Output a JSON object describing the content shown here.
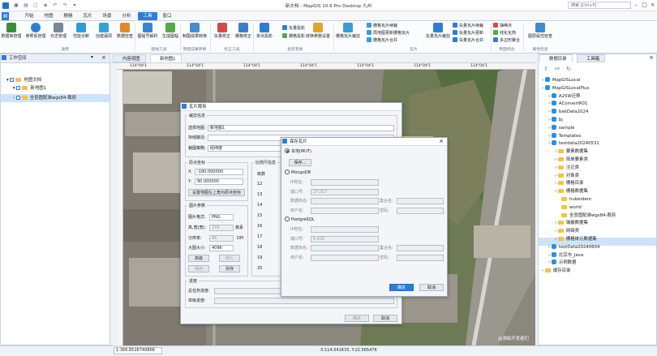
{
  "title": "新文档 - MapGIS 10.6 Pro Desktop 九州",
  "search_placeholder": "搜索 [Ctrl+F]",
  "menus": [
    "开始",
    "地图",
    "栅格",
    "瓦片",
    "场景",
    "分析",
    "工具",
    "窗口"
  ],
  "active_menu": "工具",
  "ribbon": {
    "buttons": [
      {
        "label": "数据库管理",
        "color": "#3a8d3a"
      },
      {
        "label": "参照系管理",
        "color": "#2f7dd1"
      },
      {
        "label": "日志管理",
        "color": "#7a8797"
      },
      {
        "label": "性能诊断",
        "color": "#2f9bd6"
      },
      {
        "label": "创建漏洞",
        "color": "#36a0d9"
      },
      {
        "label": "数据检查",
        "color": "#e0892d"
      },
      {
        "label": "图幅号解析",
        "color": "#3b84d0"
      },
      {
        "label": "生成图幅",
        "color": "#58a84a"
      },
      {
        "label": "制图成果转换",
        "color": "#4b8bd1"
      },
      {
        "label": "矢量校正",
        "color": "#d14b4b"
      },
      {
        "label": "栅格校正",
        "color": "#3a7fc8"
      },
      {
        "label": "单点投影",
        "color": "#2f7dd1"
      },
      {
        "label": "转换参数设置",
        "color": "#e0a52d"
      },
      {
        "label": "栅格瓦片裁剪",
        "color": "#3a9cd6"
      },
      {
        "label": "矢量瓦片裁剪",
        "color": "#2f7dd1"
      },
      {
        "label": "图层属性检查",
        "color": "#3d8bd1"
      }
    ],
    "small": {
      "proj1": "矢量投影",
      "proj2": "栅格投影",
      "tile1": "栅格瓦片续裁",
      "tile2": "局地图更新栅格瓦片",
      "tile3": "栅格瓦片合并",
      "vtile1": "矢量瓦片续裁",
      "vtile2": "矢量瓦片更新",
      "vtile3": "矢量瓦片合并",
      "gen1": "抽稀点",
      "gen2": "线化化简",
      "gen3": "多边形聚合"
    },
    "groups": [
      "通用",
      "图幅工具",
      "制图成果转换",
      "校正工具",
      "投影变换",
      "瓦片",
      "制图综合",
      "属性检查"
    ]
  },
  "left_panel": {
    "title": "工作空间",
    "items": [
      "地图文档",
      "新地图1",
      "全景图配准wgs84-裁剪"
    ]
  },
  "tabs": [
    "内容视图",
    "新地图1"
  ],
  "ruler_marks": [
    "114°04'1",
    "114°04'1",
    "114°04'1",
    "114°04'1",
    "114°04'1",
    "114°04'1",
    "114°04'1"
  ],
  "watermark": "@测绘开发者们",
  "clip_dialog": {
    "title": "瓦片裁剪",
    "section_info": "裁剪信息",
    "map_label": "选择地图:",
    "map_value": "新地图1",
    "path_label": "存储路径:",
    "scheme_label": "裁图策略:",
    "scheme_value": "经纬度",
    "origin_title": "原点坐标",
    "x_label": "X:",
    "x_value": "-180.000000",
    "y_label": "Y:",
    "y_value": "90.000000",
    "set_origin": "设置地图左上角为原点坐标",
    "img_title": "图片参数",
    "fmt_label": "图片格式:",
    "fmt_value": "PNG",
    "wh_label": "高,宽(宽):",
    "wh_value": "256",
    "wh_unit": "像素",
    "dpi_label": "分辨率:",
    "dpi_value": "96",
    "dpi_unit": "DPI",
    "size_label": "大图大小:",
    "size_value": "4096",
    "adv": "高级",
    "import": "导入",
    "save": "保存",
    "saveas": "另存",
    "scale_title": "比例尺信息",
    "level_col": "级数",
    "levels": [
      "12",
      "13",
      "14",
      "15",
      "16",
      "17",
      "18",
      "19",
      "20"
    ],
    "progress_title": "进度",
    "total_label": "总任务进度:",
    "single_label": "单级进度:",
    "ok": "确定",
    "cancel": "取消"
  },
  "save_dialog": {
    "title": "保存瓦片",
    "local": "本地(MUT)",
    "save_btn": "保存...",
    "mongo": "MongoDB",
    "ip_label": "IP地址:",
    "port_label": "端口号:",
    "mongo_port": "27,017",
    "db_label": "数据库名:",
    "col_label": "集合名:",
    "user_label": "用户名:",
    "pwd_label": "密码:",
    "pg": "PostgreSQL",
    "pg_port": "5,432",
    "ok": "确定",
    "cancel": "取消"
  },
  "right_panel": {
    "tabs": [
      "数据目录",
      "工具箱"
    ],
    "items": [
      {
        "label": "MapGISLocal",
        "indent": 0,
        "icon": "cyl"
      },
      {
        "label": "MapGISLocalPlus",
        "indent": 0,
        "icon": "cyl"
      },
      {
        "label": "A25W迁移",
        "indent": 1,
        "icon": "cyl"
      },
      {
        "label": "AConvertR01",
        "indent": 1,
        "icon": "cyl"
      },
      {
        "label": "bakData2024",
        "indent": 1,
        "icon": "cyl"
      },
      {
        "label": "bj",
        "indent": 1,
        "icon": "cyl"
      },
      {
        "label": "sample",
        "indent": 1,
        "icon": "cyl"
      },
      {
        "label": "Templates",
        "indent": 1,
        "icon": "cyl"
      },
      {
        "label": "testdata20240531",
        "indent": 1,
        "icon": "cyl"
      },
      {
        "label": "要素数据集",
        "indent": 2,
        "icon": "fold"
      },
      {
        "label": "简单要素类",
        "indent": 2,
        "icon": "fold"
      },
      {
        "label": "注记类",
        "indent": 2,
        "icon": "fold"
      },
      {
        "label": "对象类",
        "indent": 2,
        "icon": "fold"
      },
      {
        "label": "栅格目录",
        "indent": 2,
        "icon": "fold"
      },
      {
        "label": "栅格数据集",
        "indent": 2,
        "icon": "fold"
      },
      {
        "label": "hubeidem",
        "indent": 3,
        "icon": "fold"
      },
      {
        "label": "world",
        "indent": 3,
        "icon": "fold"
      },
      {
        "label": "全景图配准wgs84-裁剪",
        "indent": 3,
        "icon": "fold",
        "selected": true
      },
      {
        "label": "镶嵌数据集",
        "indent": 2,
        "icon": "fold"
      },
      {
        "label": "网络类",
        "indent": 2,
        "icon": "fold"
      },
      {
        "label": "栅格体元数据集",
        "indent": 2,
        "icon": "fold"
      },
      {
        "label": "testData20240604",
        "indent": 1,
        "icon": "cyl"
      },
      {
        "label": "北京市_Java",
        "indent": 1,
        "icon": "cyl"
      },
      {
        "label": "示例数据",
        "indent": 1,
        "icon": "cyl"
      },
      {
        "label": "缓存目录",
        "indent": 0,
        "icon": "fold"
      }
    ]
  },
  "status": {
    "scale": "1:366.8526740868",
    "coords": "X:114.041633, Y:22.565476"
  },
  "colors": {
    "accent": "#2f7dd1",
    "selection": "#cfe3f8"
  }
}
